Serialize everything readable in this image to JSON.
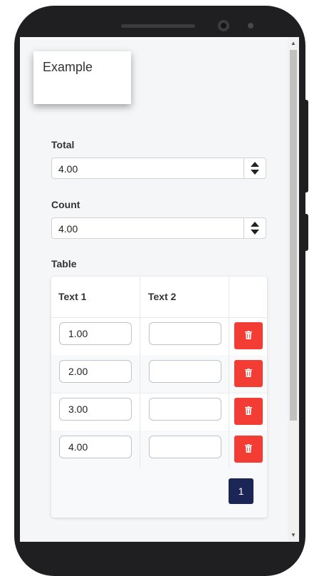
{
  "example_card": {
    "title": "Example"
  },
  "total": {
    "label": "Total",
    "value": "4.00"
  },
  "count": {
    "label": "Count",
    "value": "4.00"
  },
  "table": {
    "label": "Table",
    "headers": [
      "Text 1",
      "Text 2",
      ""
    ],
    "rows": [
      {
        "text1": "1.00",
        "text2": ""
      },
      {
        "text1": "2.00",
        "text2": ""
      },
      {
        "text1": "3.00",
        "text2": ""
      },
      {
        "text1": "4.00",
        "text2": ""
      }
    ]
  },
  "pagination": {
    "current_page": "1"
  },
  "colors": {
    "delete": "#f23c34",
    "page_active": "#1b2556",
    "background": "#f5f6f8"
  },
  "icons": {
    "delete": "trash-icon",
    "spin_up": "caret-up-icon",
    "spin_down": "caret-down-icon"
  }
}
